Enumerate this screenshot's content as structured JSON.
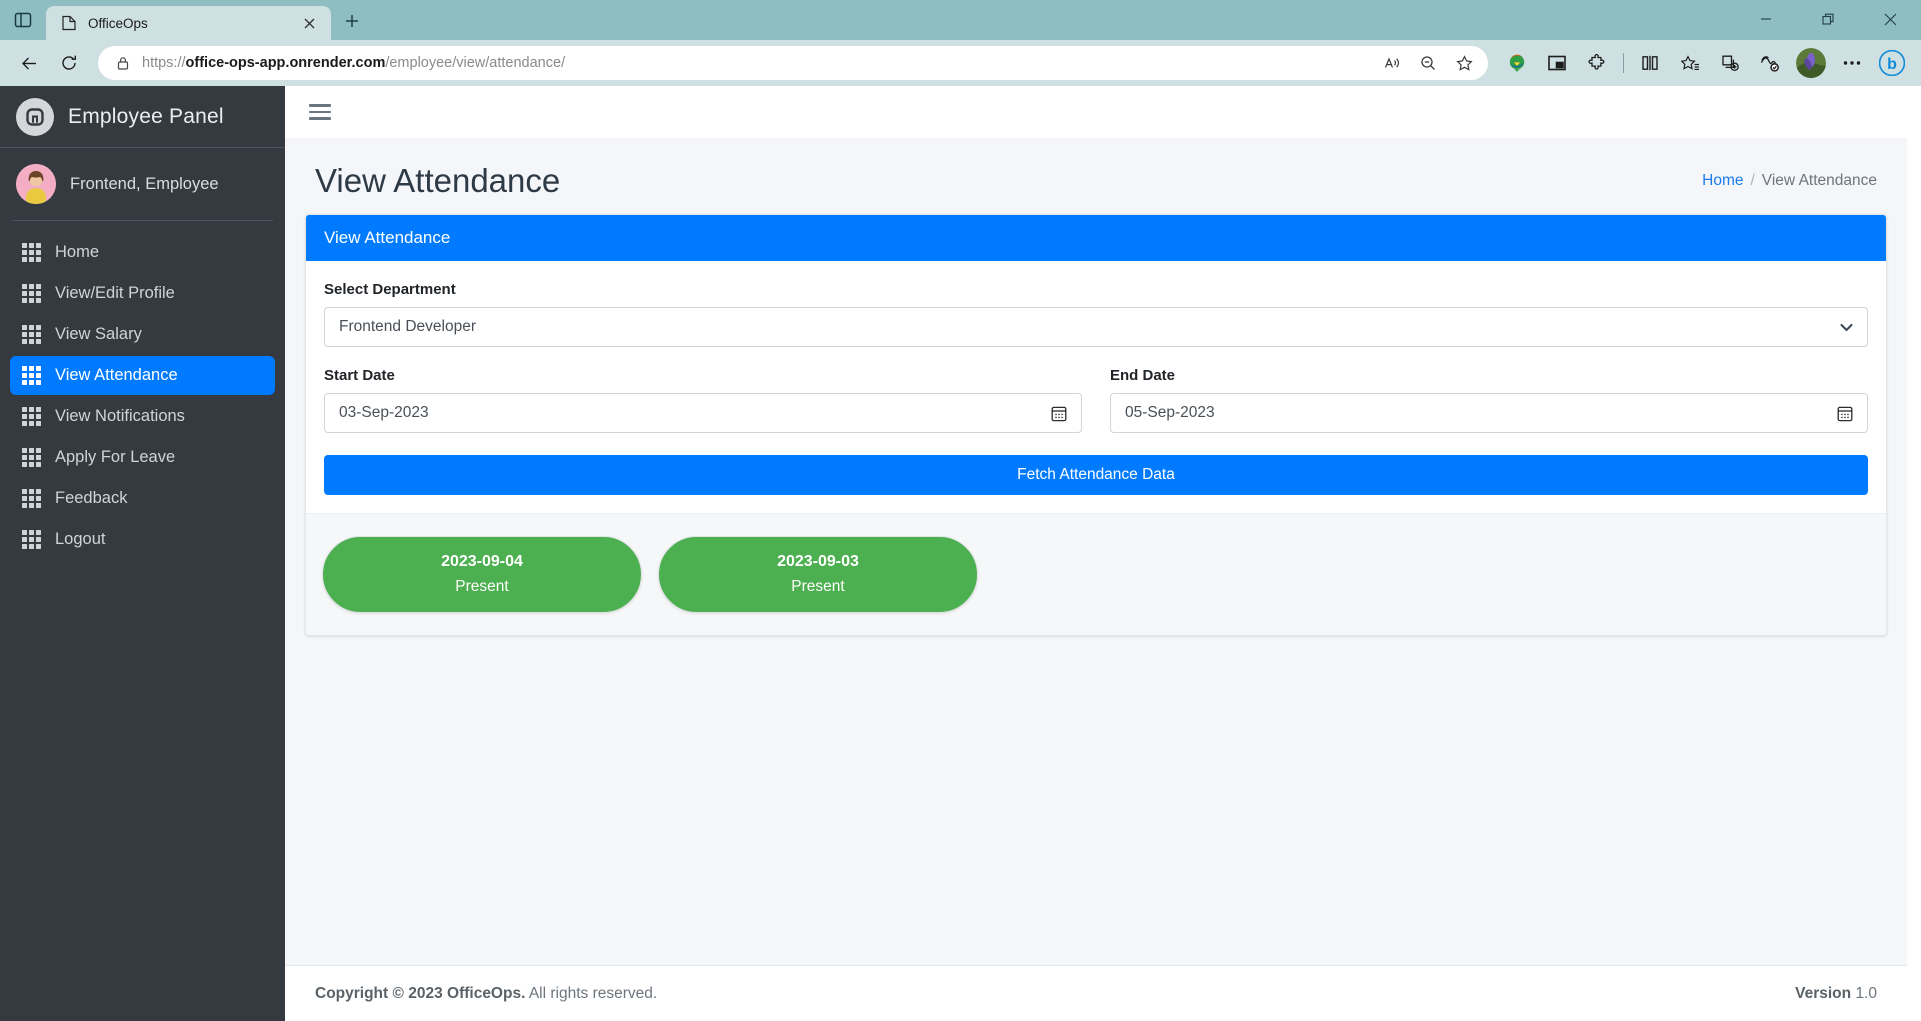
{
  "browser": {
    "tab_actions_icon": "split-pane-icon",
    "tab": {
      "favicon": "document-icon",
      "title": "OfficeOps",
      "close_icon": "close-icon"
    },
    "new_tab_label": "+",
    "window_controls": {
      "minimize": "minimize-icon",
      "restore": "restore-icon",
      "close": "close-icon"
    },
    "nav": {
      "back": "back-arrow-icon",
      "reload": "reload-icon"
    },
    "omnibox": {
      "lock_icon": "lock-icon",
      "url_bold": "office-ops-app.onrender.com",
      "url_prefix": "https://",
      "url_path": "/employee/view/attendance/",
      "read_aloud_icon": "read-aloud-icon",
      "zoom_icon": "zoom-out-icon",
      "favorite_icon": "star-icon"
    },
    "extensions": [
      {
        "name": "idm-extension-icon"
      },
      {
        "name": "picture-in-picture-icon"
      },
      {
        "name": "extensions-puzzle-icon"
      },
      {
        "name": "split-screen-icon"
      },
      {
        "name": "favorites-icon"
      },
      {
        "name": "collections-icon"
      },
      {
        "name": "browser-essentials-icon"
      }
    ],
    "profile_icon": "profile-avatar",
    "more_label": "···",
    "copilot_label": "b"
  },
  "sidebar": {
    "brand": {
      "logo_icon": "officeops-logo-icon",
      "title": "Employee Panel"
    },
    "user": {
      "avatar_icon": "user-avatar",
      "name": "Frontend, Employee"
    },
    "items": [
      {
        "label": "Home",
        "icon": "grid-icon",
        "active": false
      },
      {
        "label": "View/Edit Profile",
        "icon": "grid-icon",
        "active": false
      },
      {
        "label": "View Salary",
        "icon": "grid-icon",
        "active": false
      },
      {
        "label": "View Attendance",
        "icon": "grid-icon",
        "active": true
      },
      {
        "label": "View Notifications",
        "icon": "grid-icon",
        "active": false
      },
      {
        "label": "Apply For Leave",
        "icon": "grid-icon",
        "active": false
      },
      {
        "label": "Feedback",
        "icon": "grid-icon",
        "active": false
      },
      {
        "label": "Logout",
        "icon": "grid-icon",
        "active": false
      }
    ]
  },
  "topbar": {
    "menu_toggle_icon": "hamburger-icon"
  },
  "header": {
    "title": "View Attendance",
    "breadcrumb": {
      "home": "Home",
      "separator": "/",
      "current": "View Attendance"
    }
  },
  "card": {
    "title": "View Attendance",
    "department": {
      "label": "Select Department",
      "value": "Frontend Developer",
      "chevron_icon": "chevron-down-icon"
    },
    "start_date": {
      "label": "Start Date",
      "value": "03-Sep-2023",
      "calendar_icon": "calendar-icon"
    },
    "end_date": {
      "label": "End Date",
      "value": "05-Sep-2023",
      "calendar_icon": "calendar-icon"
    },
    "fetch_button": "Fetch Attendance Data"
  },
  "results": {
    "records": [
      {
        "date": "2023-09-04",
        "status": "Present",
        "color": "#4caf50"
      },
      {
        "date": "2023-09-03",
        "status": "Present",
        "color": "#4caf50"
      }
    ]
  },
  "footer": {
    "copyright_strong": "Copyright © 2023 OfficeOps.",
    "copyright_rest": "All rights reserved.",
    "version_label": "Version",
    "version_value": "1.0"
  },
  "colors": {
    "accent": "#007bff",
    "sidebar_bg": "#343a40",
    "present_green": "#4caf50",
    "browser_chrome": "#8ebdc2"
  }
}
